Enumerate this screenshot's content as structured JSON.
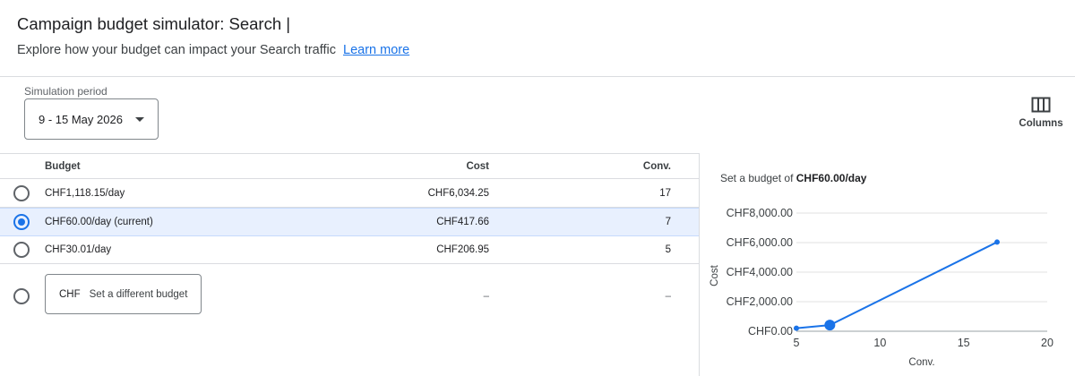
{
  "header": {
    "title": "Campaign budget simulator: Search |",
    "subtitle": "Explore how your budget can impact your Search traffic",
    "learn_more": "Learn more"
  },
  "period": {
    "label": "Simulation period",
    "value": "9 - 15 May 2026"
  },
  "columns_button": {
    "label": "Columns",
    "icon": "columns-icon"
  },
  "table": {
    "headers": {
      "budget": "Budget",
      "cost": "Cost",
      "conv": "Conv."
    },
    "rows": [
      {
        "budget": "CHF1,118.15/day",
        "cost": "CHF6,034.25",
        "conv": "17",
        "selected": false
      },
      {
        "budget": "CHF60.00/day (current)",
        "cost": "CHF417.66",
        "conv": "7",
        "selected": true
      },
      {
        "budget": "CHF30.01/day",
        "cost": "CHF206.95",
        "conv": "5",
        "selected": false
      }
    ],
    "custom_row": {
      "prefix": "CHF",
      "placeholder": "Set a different budget",
      "cost": "–",
      "conv": "–"
    }
  },
  "chart": {
    "title_prefix": "Set a budget of",
    "title_value": "CHF60.00/day"
  },
  "colors": {
    "accent": "#1a73e8",
    "selected_row": "#e8f0fe",
    "divider": "#dadce0"
  },
  "chart_data": {
    "type": "line",
    "xlabel": "Conv.",
    "ylabel": "Cost",
    "xlim": [
      5,
      20
    ],
    "ylim": [
      0,
      8000
    ],
    "x_ticks": [
      "5",
      "10",
      "15",
      "20"
    ],
    "y_ticks": [
      "CHF0.00",
      "CHF2,000.00",
      "CHF4,000.00",
      "CHF6,000.00",
      "CHF8,000.00"
    ],
    "series": [
      {
        "x": [
          5,
          7,
          17
        ],
        "y": [
          206.95,
          417.66,
          6034.25
        ]
      }
    ],
    "highlight": {
      "x": 7,
      "y": 417.66
    },
    "grid": true
  }
}
